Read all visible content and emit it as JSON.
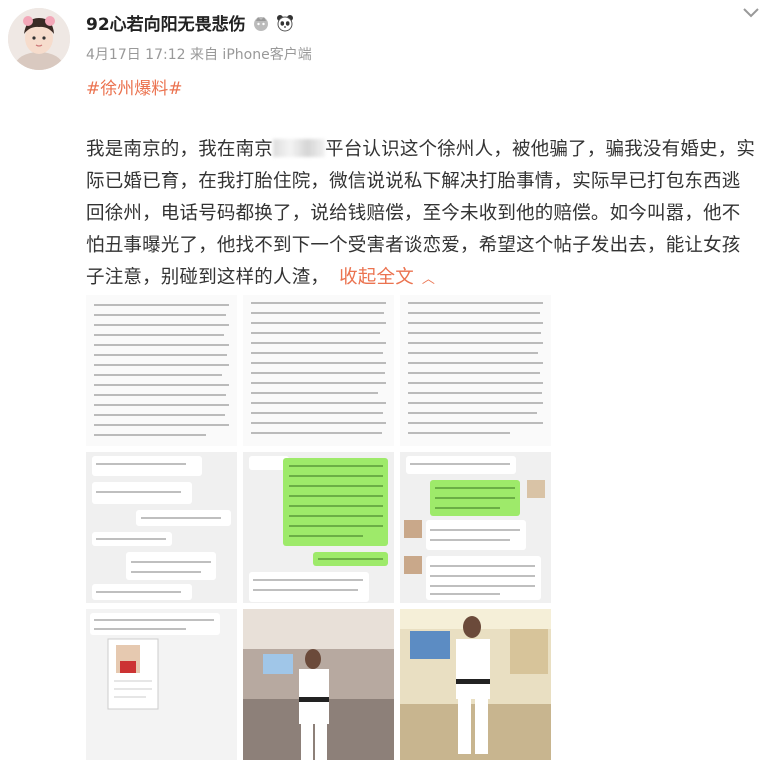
{
  "post": {
    "username": "92心若向阳无畏悲伤",
    "timestamp": "4月17日 17:12",
    "source": "来自 iPhone客户端",
    "topic": "#徐州爆料#",
    "content_part1": "我是南京的，我在南京",
    "content_part2": "平台认识这个徐州人，被他骗了，骗我没有婚史，实际已婚已育，在我打胎住院，微信说说私下解决打胎事情，实际早已打包东西逃回徐州，电话号码都换了，说给钱赔偿，至今未收到他的赔偿。如今叫嚣，他不怕丑事曝光了，他找不到下一个受害者谈恋爱，希望这个帖子发出去，能让女孩子注意，别碰到这样的人渣，",
    "collapse_label": "收起全文"
  },
  "icons": {
    "badge1": "crown-badge-icon",
    "badge2": "panda-badge-icon",
    "more": "chevron-down-icon",
    "collapse": "chevron-up-icon"
  },
  "colors": {
    "topic": "#eb7350",
    "wechat_green": "#9eea6a"
  },
  "images": [
    {
      "name": "image-text-screenshot-1"
    },
    {
      "name": "image-text-screenshot-2"
    },
    {
      "name": "image-text-screenshot-3"
    },
    {
      "name": "image-chat-screenshot-1"
    },
    {
      "name": "image-chat-screenshot-2"
    },
    {
      "name": "image-chat-screenshot-3"
    },
    {
      "name": "image-chat-screenshot-4"
    },
    {
      "name": "image-photo-taekwondo-1"
    },
    {
      "name": "image-photo-taekwondo-2"
    }
  ]
}
